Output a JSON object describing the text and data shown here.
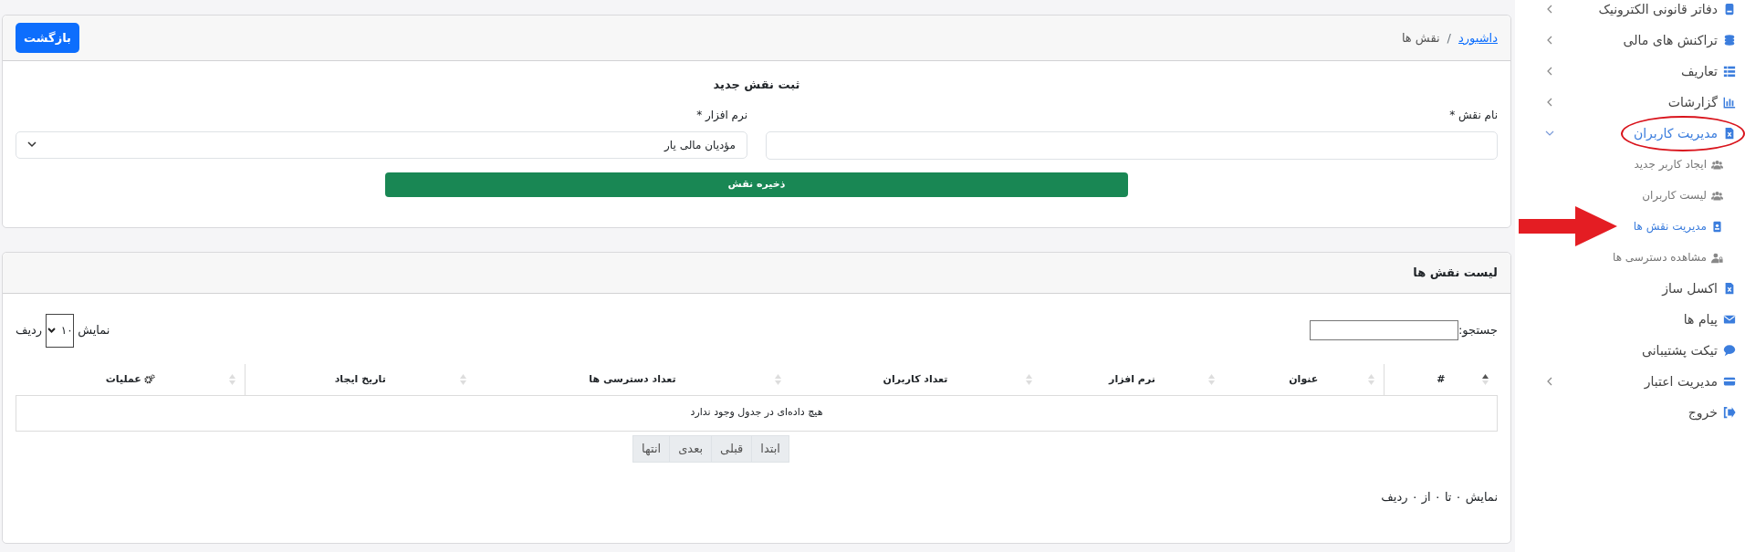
{
  "sidebar": {
    "items": [
      {
        "label": "دفاتر قانونی الکترونیک",
        "expanded": false,
        "selected": false
      },
      {
        "label": "تراکنش های مالی",
        "expanded": false,
        "selected": false
      },
      {
        "label": "تعاریف",
        "expanded": false,
        "selected": false
      },
      {
        "label": "گزارشات",
        "expanded": false,
        "selected": false
      },
      {
        "label": "مدیریت کاربران",
        "expanded": true,
        "selected": true,
        "annotation": {
          "kind": "ellipse"
        },
        "children": [
          {
            "label": "ایجاد کاربر جدید",
            "selected": false
          },
          {
            "label": "لیست کاربران",
            "selected": false
          },
          {
            "label": "مدیریت نقش ها",
            "selected": true,
            "annotation": {
              "kind": "arrow"
            }
          },
          {
            "label": "مشاهده دسترسی ها",
            "selected": false
          }
        ]
      },
      {
        "label": "اکسل ساز",
        "selected": false
      },
      {
        "label": "پیام ها",
        "selected": false
      },
      {
        "label": "تیکت پشتیبانی",
        "selected": false
      },
      {
        "label": "مدیریت اعتبار",
        "expanded": false,
        "selected": false
      },
      {
        "label": "خروج",
        "selected": false
      }
    ]
  },
  "breadcrumb": {
    "separator": "/",
    "items": [
      {
        "label": "داشبورد",
        "link": true
      },
      {
        "label": "نقش ها",
        "link": false
      }
    ]
  },
  "back_button": "بازگشت",
  "form": {
    "title": "ثبت نقش جدید",
    "fields": [
      {
        "kind": "text",
        "label": "نام نقش *"
      },
      {
        "kind": "select",
        "label": "نرم افزار *",
        "value": "مؤدیان مالی یار"
      }
    ],
    "submit": "ذخیره نقش"
  },
  "list": {
    "title": "لیست نقش ها",
    "search_label": "جستجو:",
    "length": {
      "before": "نمایش",
      "value": "۱۰",
      "after": "ردیف"
    },
    "columns": [
      {
        "label": "#",
        "sorted": true
      },
      {
        "label": "عنوان",
        "sorted": false
      },
      {
        "label": "نرم افزار",
        "sorted": false
      },
      {
        "label": "تعداد کاربران",
        "sorted": false
      },
      {
        "label": "تعداد دسترسی ها",
        "sorted": false
      },
      {
        "label": "تاریخ ایجاد",
        "sorted": false
      },
      {
        "label": "عملیات",
        "sorted": false,
        "kind": "actions"
      }
    ],
    "empty_message": "هیچ داده‌ای در جدول وجود ندارد",
    "pagination": [
      "ابتدا",
      "قبلی",
      "بعدی",
      "انتها"
    ],
    "info": "نمایش ۰ تا ۰ از ۰ ردیف"
  }
}
